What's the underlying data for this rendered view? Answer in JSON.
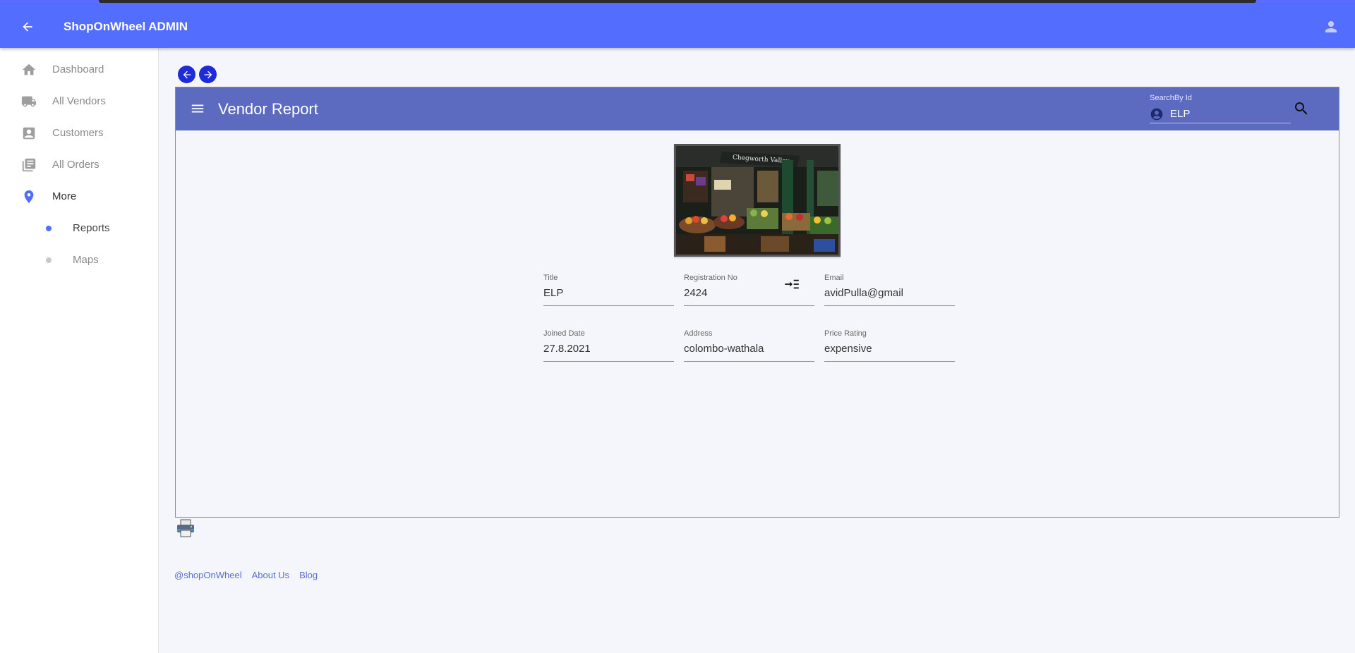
{
  "appbar": {
    "title": "ShopOnWheel ADMIN"
  },
  "sidebar": {
    "items": [
      {
        "label": "Dashboard",
        "icon": "home-icon"
      },
      {
        "label": "All Vendors",
        "icon": "truck-icon"
      },
      {
        "label": "Customers",
        "icon": "contact-icon"
      },
      {
        "label": "All Orders",
        "icon": "library-icon"
      },
      {
        "label": "More",
        "icon": "location-pin-icon"
      }
    ],
    "sub_items": [
      {
        "label": "Reports",
        "active": true
      },
      {
        "label": "Maps",
        "active": false
      }
    ]
  },
  "report": {
    "title": "Vendor Report",
    "search": {
      "label": "SearchBy Id",
      "value": "ELP"
    },
    "image_sign": "Chegworth Valley",
    "fields": [
      {
        "label": "Title",
        "value": "ELP"
      },
      {
        "label": "Registration No",
        "value": "2424"
      },
      {
        "label": "Email",
        "value": "avidPulla@gmail"
      },
      {
        "label": "Joined Date",
        "value": "27.8.2021"
      },
      {
        "label": "Address",
        "value": "colombo-wathala"
      },
      {
        "label": "Price Rating",
        "value": "expensive"
      }
    ]
  },
  "footer": {
    "links": [
      "@shopOnWheel",
      "About Us",
      "Blog"
    ]
  },
  "colors": {
    "primary": "#536dfe",
    "panel_bar": "#5c6bc0",
    "pager": "#1d2bd8",
    "background": "#f5f6fc"
  }
}
